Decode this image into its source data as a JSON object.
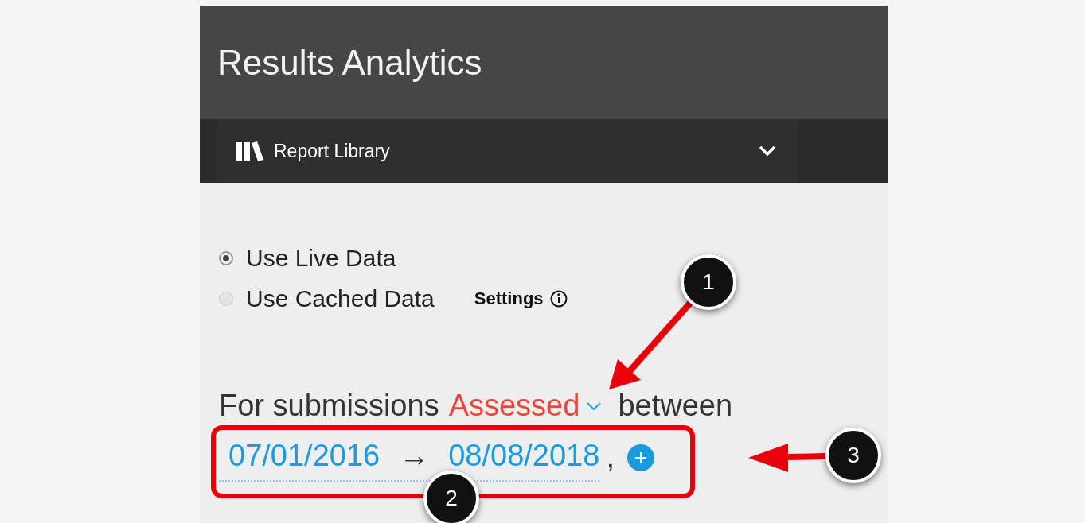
{
  "header": {
    "title": "Results Analytics"
  },
  "nav": {
    "label": "Report Library"
  },
  "data_source": [
    {
      "label": "Use Live Data",
      "selected": true
    },
    {
      "label": "Use Cached Data",
      "selected": false
    }
  ],
  "settings": {
    "label": "Settings"
  },
  "filter": {
    "prefix": "For submissions",
    "field": "Assessed",
    "suffix": "between",
    "start": "07/01/2016",
    "arrow": "→",
    "end": "08/08/2018",
    "separator": ","
  },
  "callouts": [
    {
      "number": "1"
    },
    {
      "number": "2"
    },
    {
      "number": "3"
    }
  ]
}
